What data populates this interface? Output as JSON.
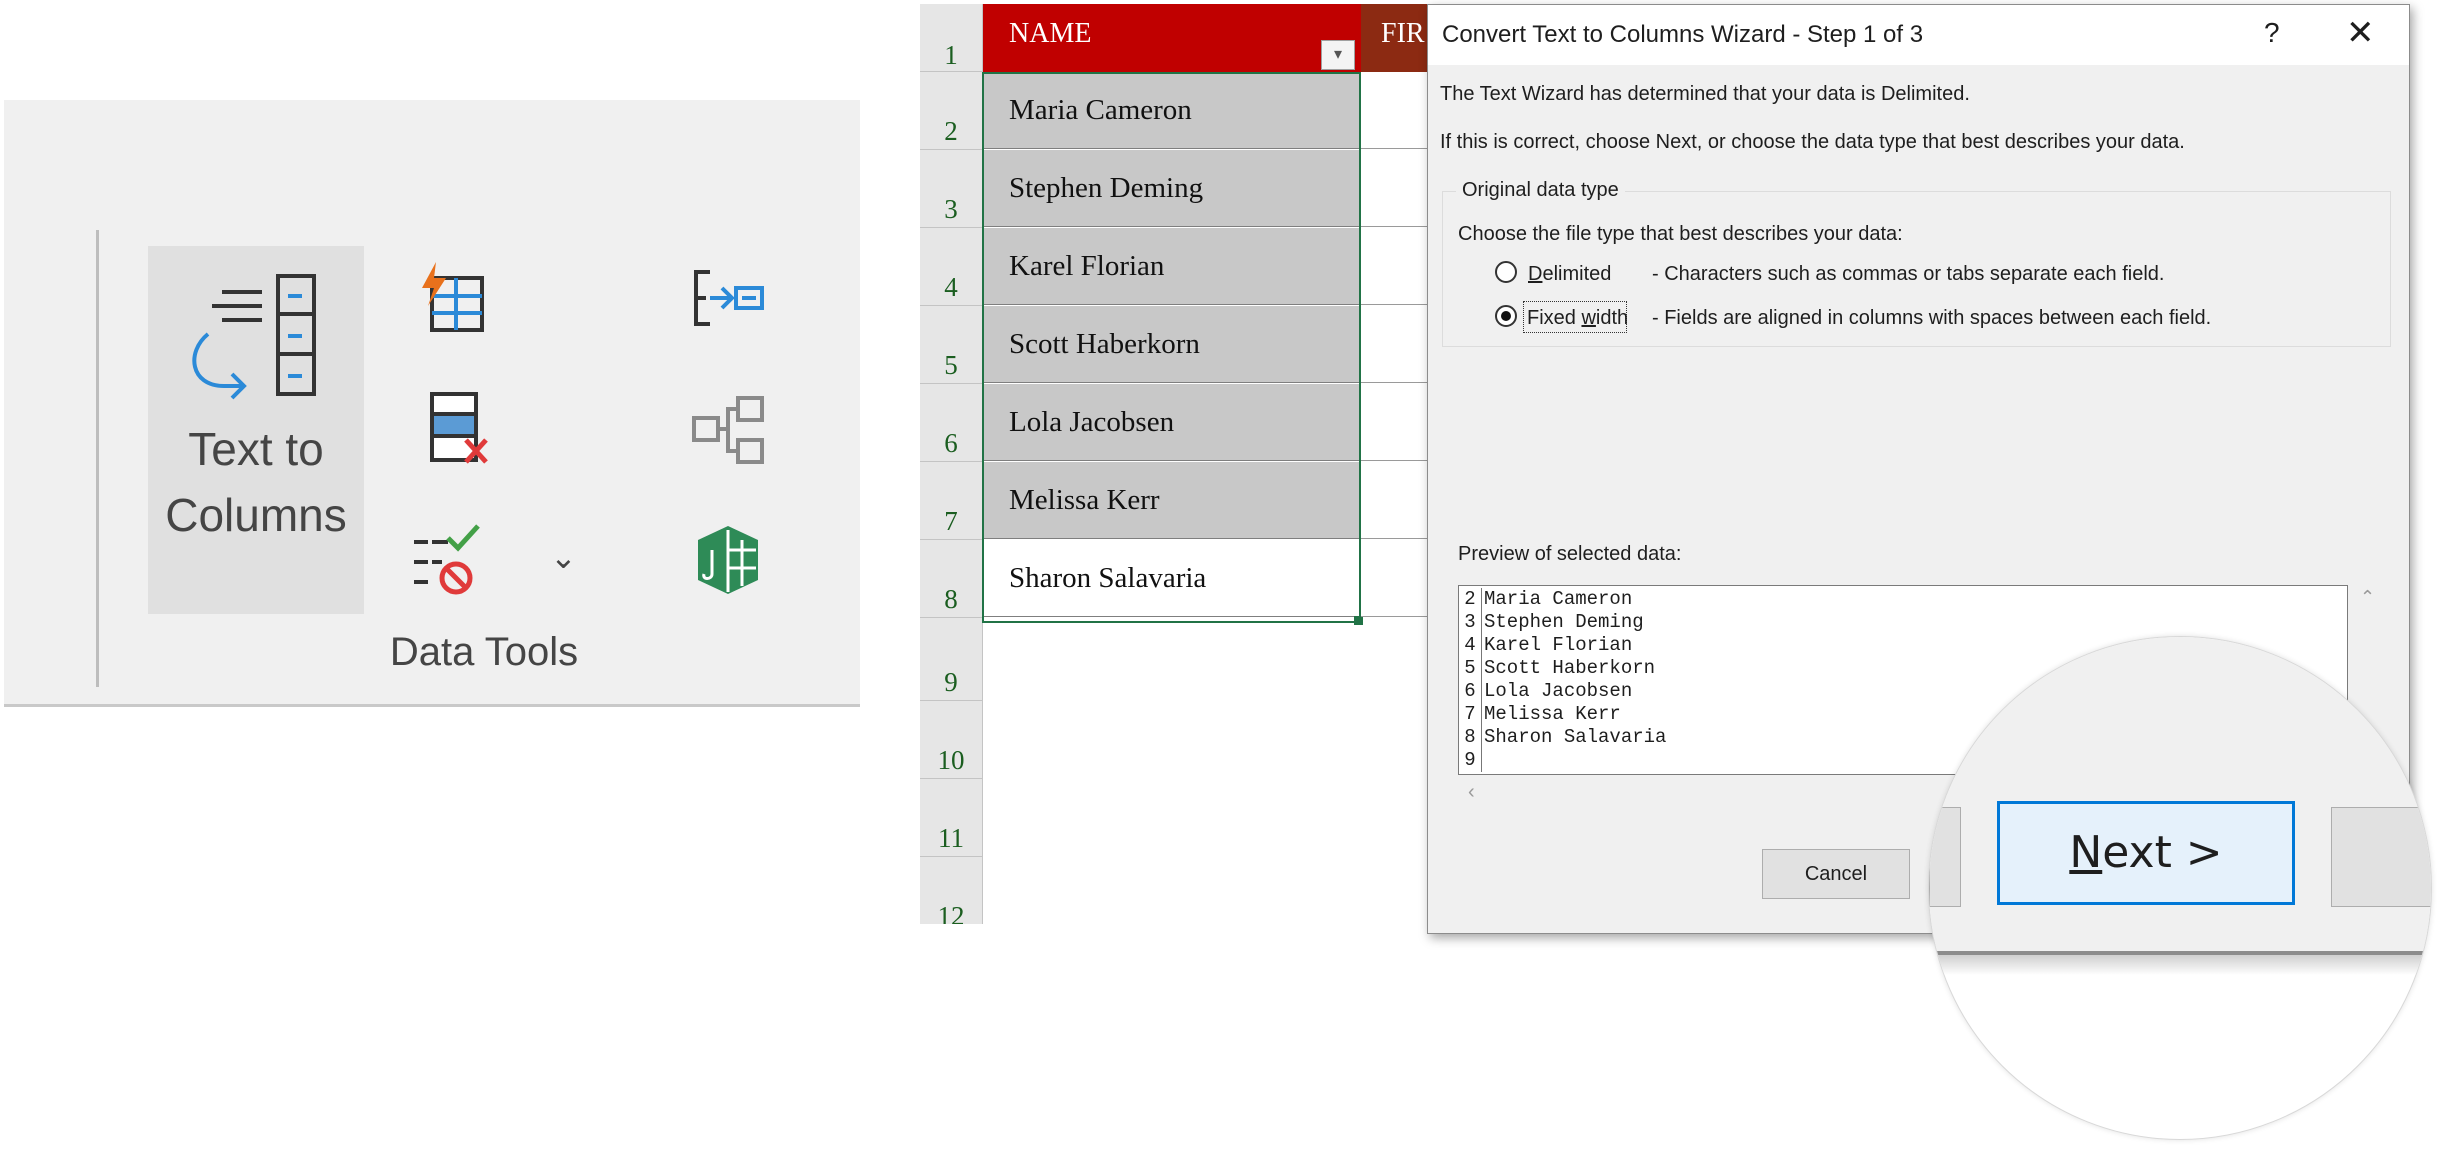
{
  "ribbon": {
    "text_to_columns_label": "Text to Columns",
    "group_label": "Data Tools",
    "icons": [
      "text-to-columns-icon",
      "flash-fill-icon",
      "remove-duplicates-icon",
      "data-validation-icon",
      "consolidate-icon",
      "relationships-icon",
      "manage-data-model-icon"
    ],
    "dropdown_glyph": "⌄"
  },
  "sheet": {
    "header": "NAME",
    "header_next": "FIR",
    "filter_glyph": "▾",
    "row_numbers": [
      "1",
      "2",
      "3",
      "4",
      "5",
      "6",
      "7",
      "8",
      "9",
      "10",
      "11",
      "12"
    ],
    "names": [
      "Maria Cameron",
      "Stephen Deming",
      "Karel Florian",
      "Scott Haberkorn",
      "Lola Jacobsen",
      "Melissa Kerr",
      "Sharon Salavaria"
    ],
    "colors": {
      "header": "#c00000",
      "header_next": "#8c2a12",
      "selection": "#217346",
      "selected_fill": "#c8c8c8"
    }
  },
  "dialog": {
    "title": "Convert Text to Columns Wizard - Step 1 of 3",
    "help": "?",
    "close": "✕",
    "intro_line1": "The Text Wizard has determined that your data is Delimited.",
    "intro_line2": "If this is correct, choose Next, or choose the data type that best describes your data.",
    "group_title": "Original data type",
    "choose_prompt": "Choose the file type that best describes your data:",
    "delimited_label": {
      "pre": "",
      "key": "D",
      "post": "elimited"
    },
    "delimited_desc": "- Characters such as commas or tabs separate each field.",
    "fixed_label": {
      "pre": "Fixed ",
      "key": "w",
      "post": "idth"
    },
    "fixed_desc": "- Fields are aligned in columns with spaces between each field.",
    "selected_type": "Fixed width",
    "preview_label": "Preview of selected data:",
    "preview_rows": [
      {
        "n": "2",
        "text": "Maria Cameron"
      },
      {
        "n": "3",
        "text": "Stephen Deming"
      },
      {
        "n": "4",
        "text": "Karel Florian"
      },
      {
        "n": "5",
        "text": "Scott Haberkorn"
      },
      {
        "n": "6",
        "text": "Lola Jacobsen"
      },
      {
        "n": "7",
        "text": "Melissa Kerr"
      },
      {
        "n": "8",
        "text": "Sharon Salavaria"
      },
      {
        "n": "9",
        "text": ""
      }
    ],
    "scroll_up": "⌃",
    "scroll_left": "‹",
    "cancel_label": "Cancel",
    "next_label": {
      "key": "N",
      "rest": "ext >"
    },
    "accent": "#0078d7"
  }
}
